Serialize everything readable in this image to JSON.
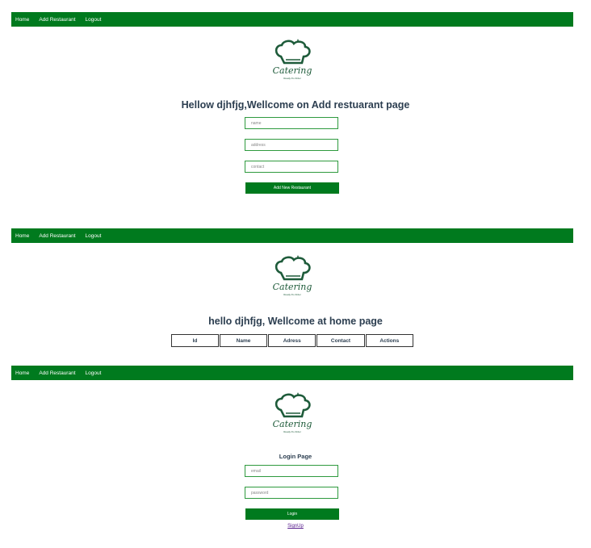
{
  "nav": {
    "home": "Home",
    "add_restaurant": "Add Restaurant",
    "logout": "Logout"
  },
  "logo": {
    "text": "Catering",
    "tagline": "Ready-To-Order"
  },
  "add_page": {
    "heading": "Hellow djhfjg,Wellcome on Add restuarant page",
    "name_placeholder": "name",
    "address_placeholder": "address",
    "contact_placeholder": "contact",
    "button_label": "Add New Restaurant"
  },
  "home_page": {
    "heading": "hello djhfjg, Wellcome at home page",
    "table_headers": [
      "Id",
      "Name",
      "Adress",
      "Contact",
      "Actions"
    ]
  },
  "login_page": {
    "heading": "Login Page",
    "email_placeholder": "email",
    "password_placeholder": "password",
    "button_label": "Login",
    "signup_link": "SignUp"
  },
  "colors": {
    "nav_green": "#007a1e",
    "field_border": "#2e9a3e",
    "logo_green": "#1e5b3a"
  }
}
